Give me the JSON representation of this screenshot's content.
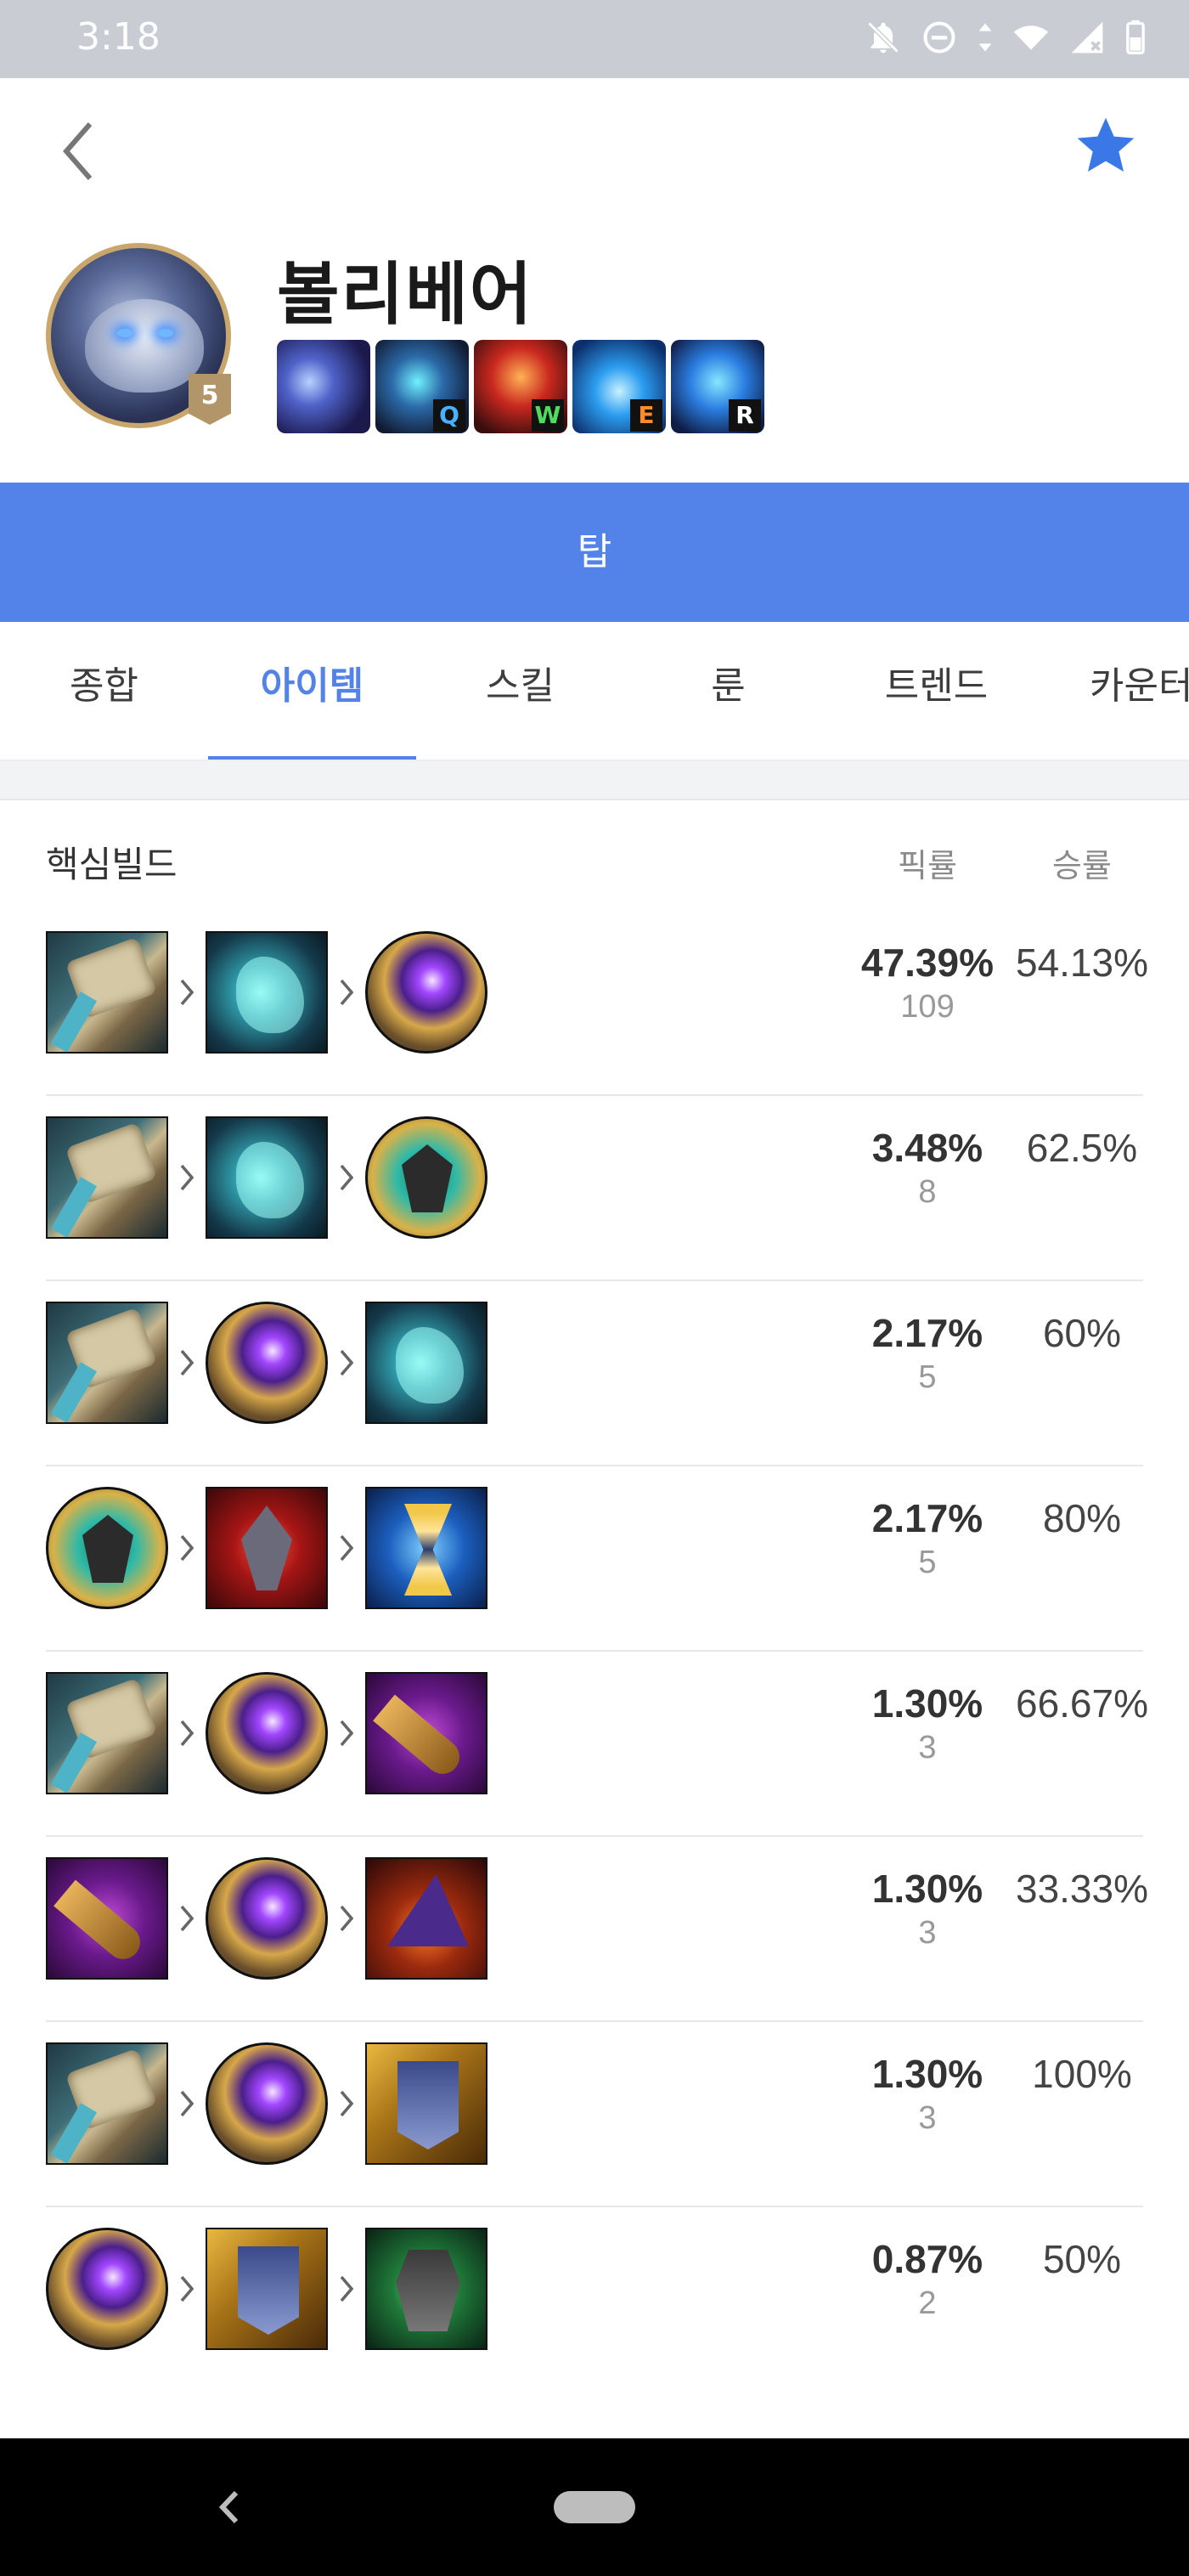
{
  "status_bar": {
    "time": "3:18",
    "icons": [
      "notifications-off-icon",
      "do-not-disturb-icon",
      "data-arrows-icon",
      "wifi-icon",
      "cell-signal-icon",
      "battery-icon"
    ]
  },
  "nav": {
    "back_icon": "chevron-left-icon",
    "favorite_icon": "star-icon",
    "favorite_color": "#3b78e7"
  },
  "champion": {
    "name": "볼리베어",
    "level": "5",
    "skills": [
      {
        "name": "passive",
        "key": ""
      },
      {
        "name": "q",
        "key": "Q"
      },
      {
        "name": "w",
        "key": "W"
      },
      {
        "name": "e",
        "key": "E"
      },
      {
        "name": "r",
        "key": "R"
      }
    ]
  },
  "lane": {
    "label": "탑",
    "color": "#5383e8"
  },
  "tabs": [
    {
      "label": "종합",
      "active": false
    },
    {
      "label": "아이템",
      "active": true
    },
    {
      "label": "스킬",
      "active": false
    },
    {
      "label": "룬",
      "active": false
    },
    {
      "label": "트렌드",
      "active": false
    },
    {
      "label": "카운터",
      "active": false
    }
  ],
  "core_build": {
    "title": "핵심빌드",
    "col_pick": "픽률",
    "col_win": "승률",
    "rows": [
      {
        "items": [
          "hammer",
          "claw",
          "orb"
        ],
        "pick_rate": "47.39%",
        "pick_count": "109",
        "win_rate": "54.13%"
      },
      {
        "items": [
          "hammer",
          "claw",
          "shield"
        ],
        "pick_rate": "3.48%",
        "pick_count": "8",
        "win_rate": "62.5%"
      },
      {
        "items": [
          "hammer",
          "orb",
          "claw"
        ],
        "pick_rate": "2.17%",
        "pick_count": "5",
        "win_rate": "60%"
      },
      {
        "items": [
          "shield",
          "spike",
          "hourglass"
        ],
        "pick_rate": "2.17%",
        "pick_count": "5",
        "win_rate": "80%"
      },
      {
        "items": [
          "hammer",
          "orb",
          "dagger"
        ],
        "pick_rate": "1.30%",
        "pick_count": "3",
        "win_rate": "66.67%"
      },
      {
        "items": [
          "dagger",
          "orb",
          "hat"
        ],
        "pick_rate": "1.30%",
        "pick_count": "3",
        "win_rate": "33.33%"
      },
      {
        "items": [
          "hammer",
          "orb",
          "banner"
        ],
        "pick_rate": "1.30%",
        "pick_count": "3",
        "win_rate": "100%"
      },
      {
        "items": [
          "orb",
          "banner",
          "armor"
        ],
        "pick_rate": "0.87%",
        "pick_count": "2",
        "win_rate": "50%"
      }
    ]
  }
}
